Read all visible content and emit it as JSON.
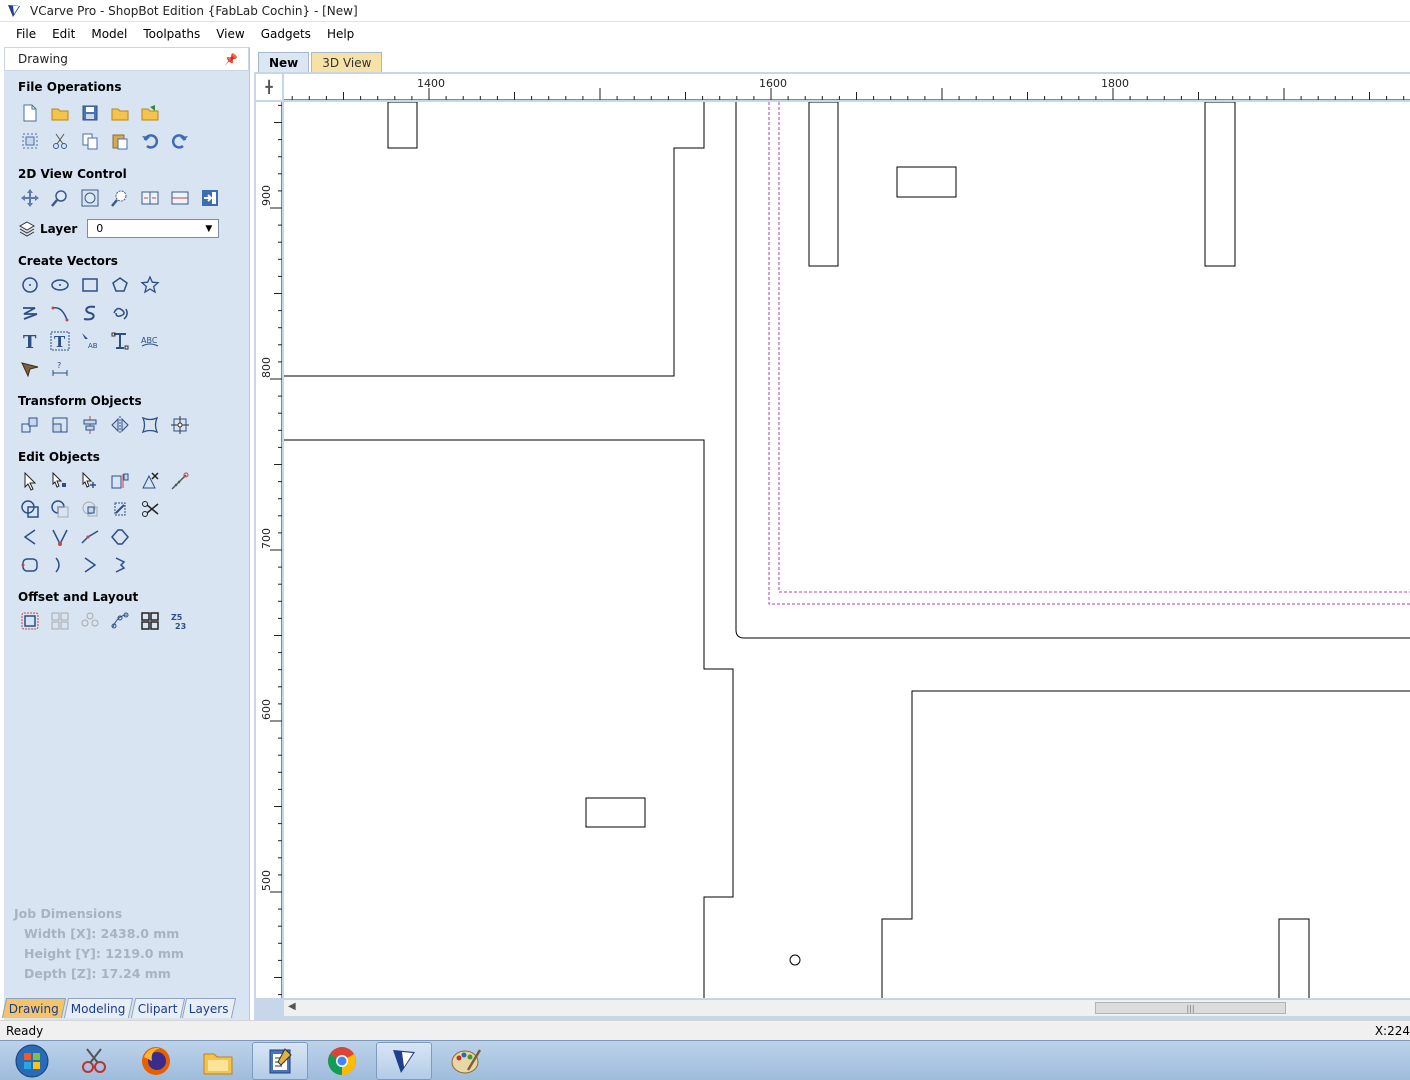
{
  "window": {
    "title": "VCarve Pro - ShopBot Edition {FabLab Cochin} - [New]",
    "app_icon": "vcarve-logo-icon"
  },
  "menu": [
    "File",
    "Edit",
    "Model",
    "Toolpaths",
    "View",
    "Gadgets",
    "Help"
  ],
  "panel": {
    "title": "Drawing",
    "pin_icon": "pin-icon",
    "sections": {
      "file_operations": "File Operations",
      "view_control": "2D View Control",
      "create_vectors": "Create Vectors",
      "transform_objects": "Transform Objects",
      "edit_objects": "Edit Objects",
      "offset_layout": "Offset and Layout"
    },
    "layer": {
      "label": "Layer",
      "value": "0"
    },
    "job_dimensions": {
      "title": "Job Dimensions",
      "width": "Width  [X]: 2438.0 mm",
      "height": "Height [Y]: 1219.0 mm",
      "depth": "Depth  [Z]: 17.24 mm"
    },
    "tabs": [
      "Drawing",
      "Modeling",
      "Clipart",
      "Layers"
    ],
    "active_tab": "Drawing"
  },
  "doc_tabs": [
    "New",
    "3D View"
  ],
  "active_doc_tab": "New",
  "rulers": {
    "horizontal_labels": [
      "1400",
      "1600",
      "1800"
    ],
    "vertical_labels": [
      "900",
      "800",
      "700",
      "600",
      "500"
    ]
  },
  "status": {
    "left": "Ready",
    "right": "X:224"
  },
  "taskbar": [
    "start-orb-icon",
    "snipping-tool-icon",
    "firefox-icon",
    "file-explorer-icon",
    "notepad-icon",
    "chrome-icon",
    "vcarve-icon",
    "paint-icon"
  ],
  "colors": {
    "panel_bg": "#d8e4f2",
    "active_tab": "#f4c46a",
    "dashed_toolpath": "#b03cc8"
  }
}
